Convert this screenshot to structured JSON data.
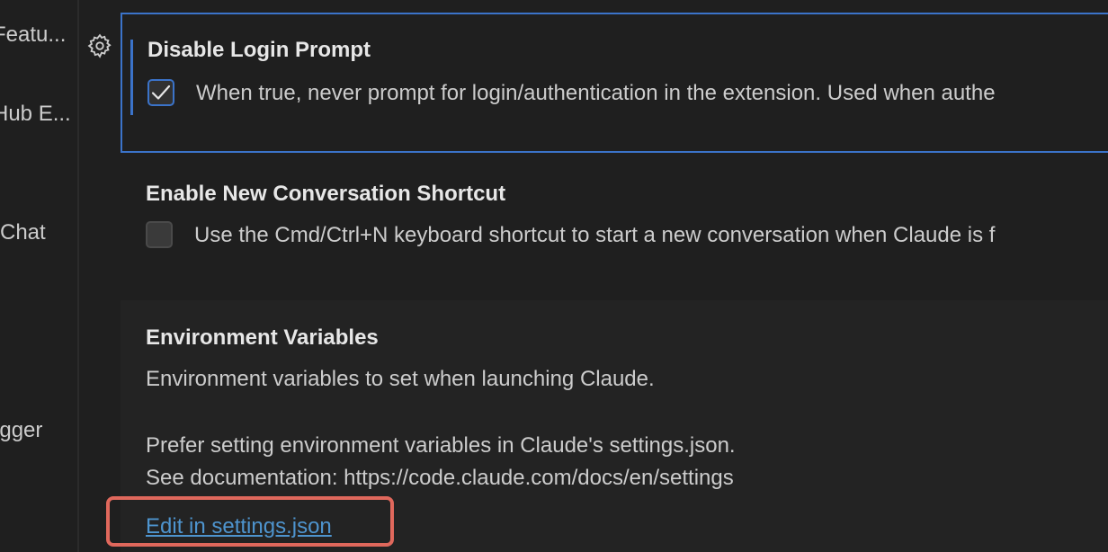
{
  "sidebar": {
    "items": [
      {
        "label": "Featu..."
      },
      {
        "label": "Hub E..."
      },
      {
        "label": "Chat"
      },
      {
        "label": "ugger"
      }
    ]
  },
  "icons": {
    "gear": "gear-icon",
    "check": "checkmark-icon"
  },
  "settings": {
    "disable_login": {
      "title": "Disable Login Prompt",
      "checked": true,
      "description": "When true, never prompt for login/authentication in the extension. Used when authe"
    },
    "new_conversation": {
      "title": "Enable New Conversation Shortcut",
      "checked": false,
      "description": "Use the Cmd/Ctrl+N keyboard shortcut to start a new conversation when Claude is f"
    },
    "env_vars": {
      "title": "Environment Variables",
      "line1": "Environment variables to set when launching Claude.",
      "line2": "Prefer setting environment variables in Claude's settings.json.",
      "line3": "See documentation: https://code.claude.com/docs/en/settings",
      "edit_link": "Edit in settings.json"
    }
  },
  "colors": {
    "accent": "#3b73c9",
    "link": "#4e94ce",
    "highlight": "#e0685c"
  }
}
